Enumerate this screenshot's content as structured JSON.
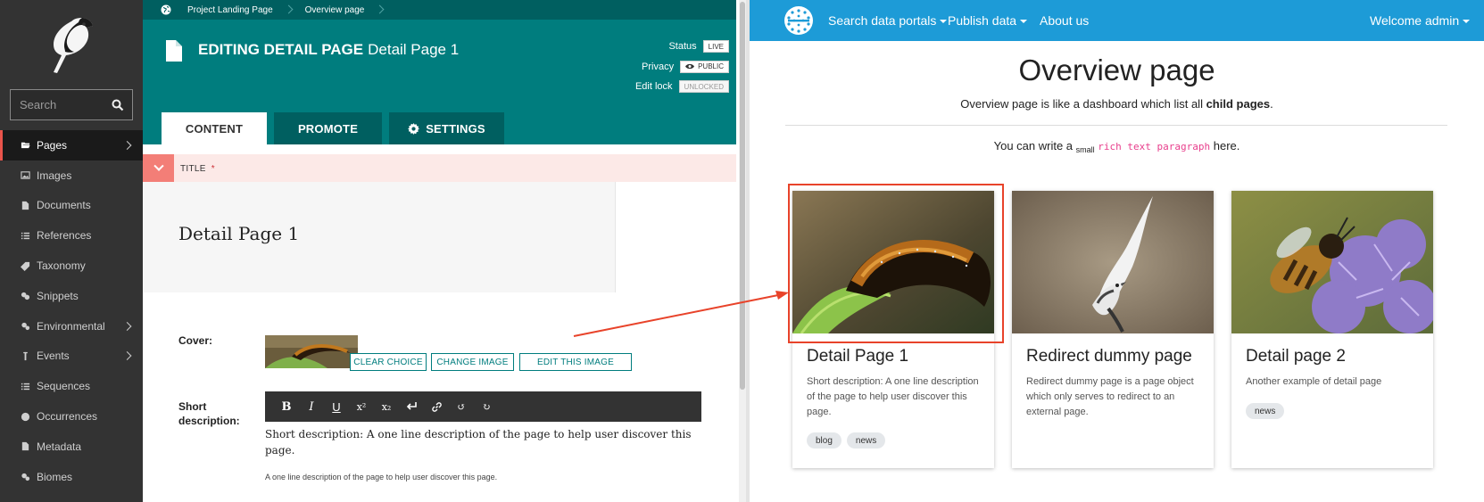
{
  "sidebar": {
    "search_placeholder": "Search",
    "items": [
      {
        "label": "Pages",
        "icon": "folder-open-icon",
        "active": true,
        "has_submenu": true
      },
      {
        "label": "Images",
        "icon": "image-icon",
        "active": false,
        "has_submenu": false
      },
      {
        "label": "Documents",
        "icon": "doc-icon",
        "active": false,
        "has_submenu": false
      },
      {
        "label": "References",
        "icon": "list-icon",
        "active": false,
        "has_submenu": false
      },
      {
        "label": "Taxonomy",
        "icon": "tag-icon",
        "active": false,
        "has_submenu": false
      },
      {
        "label": "Snippets",
        "icon": "snippet-icon",
        "active": false,
        "has_submenu": false
      },
      {
        "label": "Environmental",
        "icon": "cogs-icon",
        "active": false,
        "has_submenu": true
      },
      {
        "label": "Events",
        "icon": "pin-icon",
        "active": false,
        "has_submenu": true
      },
      {
        "label": "Sequences",
        "icon": "list-icon",
        "active": false,
        "has_submenu": false
      },
      {
        "label": "Occurrences",
        "icon": "globe-icon",
        "active": false,
        "has_submenu": false
      },
      {
        "label": "Metadata",
        "icon": "doc-icon",
        "active": false,
        "has_submenu": false
      },
      {
        "label": "Biomes",
        "icon": "cogs-icon",
        "active": false,
        "has_submenu": false
      }
    ]
  },
  "editor": {
    "breadcrumb": [
      "Project Landing Page",
      "Overview page"
    ],
    "heading_prefix": "EDITING DETAIL PAGE",
    "heading_title": "Detail Page 1",
    "status_label": "Status",
    "status_value": "LIVE",
    "privacy_label": "Privacy",
    "privacy_value": "PUBLIC",
    "lock_label": "Edit lock",
    "lock_value": "UNLOCKED",
    "tabs": {
      "content": "CONTENT",
      "promote": "PROMOTE",
      "settings": "SETTINGS"
    },
    "title_label": "TITLE",
    "title_required": "*",
    "title_value": "Detail Page 1",
    "cover_label": "Cover:",
    "clear_choice": "CLEAR CHOICE",
    "change_image": "CHANGE IMAGE",
    "edit_image": "EDIT THIS IMAGE",
    "short_desc_label": "Short description:",
    "toolbar": {
      "bold": "B",
      "italic": "I",
      "underline": "U",
      "superscript": "x²",
      "subscript": "x₂",
      "undo": "↺",
      "redo": "↻"
    },
    "short_desc_value": "Short description: A one line description of the page to help user discover this page.",
    "help_text": "A one line description of the page to help user discover this page."
  },
  "preview": {
    "nav": {
      "search": "Search data portals",
      "publish": "Publish data",
      "about": "About us",
      "welcome": "Welcome admin"
    },
    "title": "Overview page",
    "intro_before": "Overview page is like a dashboard which list all ",
    "intro_bold": "child pages",
    "intro_after": ".",
    "rich_before": "You can write a ",
    "rich_small": "small",
    "rich_code": "rich text paragraph",
    "rich_after": " here.",
    "cards": [
      {
        "title": "Detail Page 1",
        "text": "Short description: A one line description of the page to help user discover this page.",
        "tags": [
          "blog",
          "news"
        ]
      },
      {
        "title": "Redirect dummy page",
        "text": "Redirect dummy page is a page object which only serves to redirect to an external page.",
        "tags": []
      },
      {
        "title": "Detail page 2",
        "text": "Another example of detail page",
        "tags": [
          "news"
        ]
      }
    ]
  },
  "colors": {
    "wagtail_teal": "#007d7e",
    "wagtail_dark_teal": "#005f60",
    "sidebar_bg": "#333333",
    "navbar_blue": "#1d9bd7",
    "highlight_red": "#e8432a",
    "required_red": "#cd3238"
  }
}
